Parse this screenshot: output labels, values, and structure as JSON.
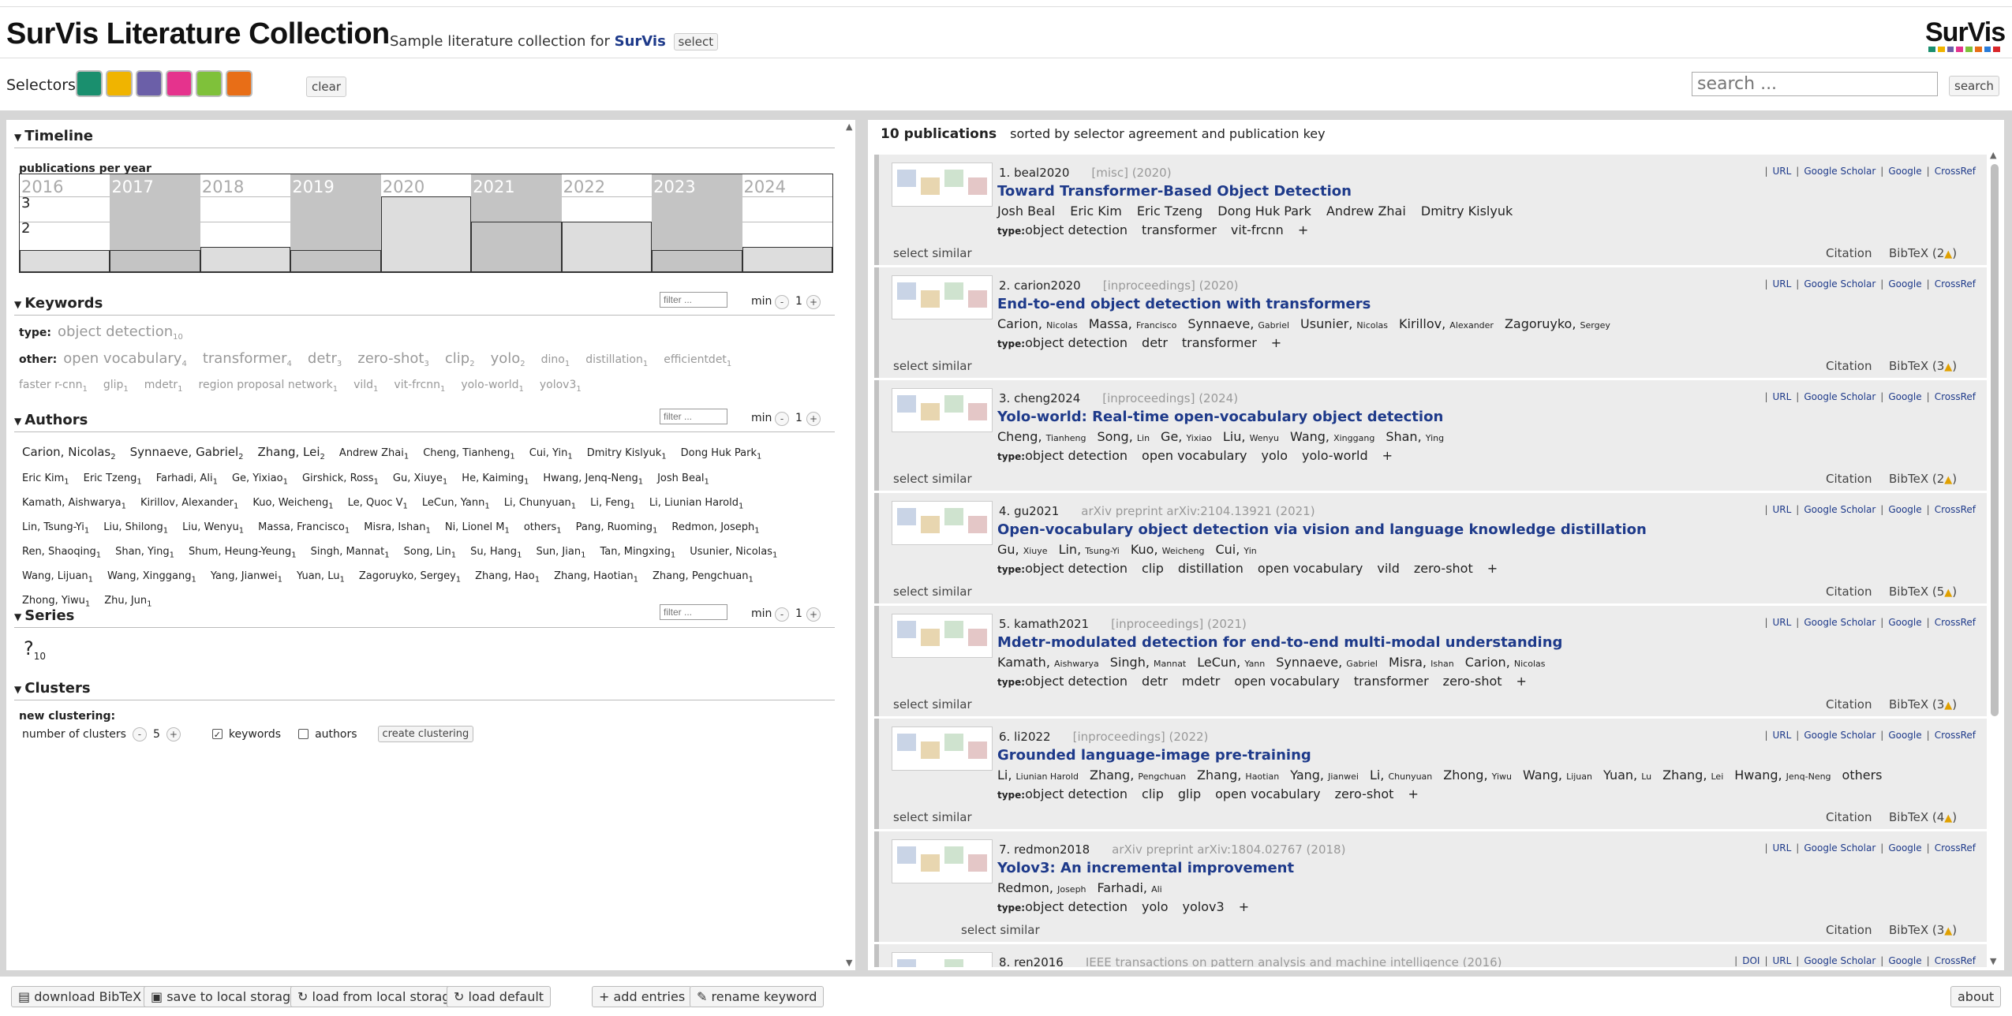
{
  "app": {
    "title": "SurVis Literature Collection",
    "subtitle_prefix": "Sample literature collection for",
    "subtitle_link": "SurVis",
    "select_label": "select",
    "logo_text": "SurVis",
    "logo_colors": [
      "#1a8f6e",
      "#f0b400",
      "#6b5fa8",
      "#e5338d",
      "#7fc13a",
      "#e86e17",
      "#2a7bd8",
      "#d9262a"
    ]
  },
  "selectors": {
    "label": "Selectors",
    "colors": [
      "#1a8f6e",
      "#f0b400",
      "#6b5fa8",
      "#e5338d",
      "#7fc13a",
      "#e86e17"
    ],
    "clear_label": "clear"
  },
  "search": {
    "placeholder": "search ...",
    "button": "search"
  },
  "timeline": {
    "section_title": "Timeline",
    "label": "publications per year",
    "ticks": [
      "3",
      "2"
    ],
    "years": [
      {
        "year": "2016",
        "count": 0
      },
      {
        "year": "2017",
        "count": 0
      },
      {
        "year": "2018",
        "count": 1
      },
      {
        "year": "2019",
        "count": 0
      },
      {
        "year": "2020",
        "count": 3
      },
      {
        "year": "2021",
        "count": 2
      },
      {
        "year": "2022",
        "count": 2
      },
      {
        "year": "2023",
        "count": 0
      },
      {
        "year": "2024",
        "count": 1
      }
    ]
  },
  "keywords": {
    "section_title": "Keywords",
    "filter_placeholder": "filter ...",
    "min_label": "min",
    "min_value": "1",
    "type_label": "type:",
    "type_tags": [
      {
        "name": "object detection",
        "count": "10"
      }
    ],
    "other_label": "other:",
    "other_tags": [
      {
        "name": "open vocabulary",
        "count": "4"
      },
      {
        "name": "transformer",
        "count": "4"
      },
      {
        "name": "detr",
        "count": "3"
      },
      {
        "name": "zero-shot",
        "count": "3"
      },
      {
        "name": "clip",
        "count": "2"
      },
      {
        "name": "yolo",
        "count": "2"
      },
      {
        "name": "dino",
        "count": "1"
      },
      {
        "name": "distillation",
        "count": "1"
      },
      {
        "name": "efficientdet",
        "count": "1"
      },
      {
        "name": "faster r-cnn",
        "count": "1"
      },
      {
        "name": "glip",
        "count": "1"
      },
      {
        "name": "mdetr",
        "count": "1"
      },
      {
        "name": "region proposal network",
        "count": "1"
      },
      {
        "name": "vild",
        "count": "1"
      },
      {
        "name": "vit-frcnn",
        "count": "1"
      },
      {
        "name": "yolo-world",
        "count": "1"
      },
      {
        "name": "yolov3",
        "count": "1"
      }
    ]
  },
  "authors": {
    "section_title": "Authors",
    "filter_placeholder": "filter ...",
    "min_label": "min",
    "min_value": "1",
    "list": [
      {
        "name": "Carion, Nicolas",
        "count": "2"
      },
      {
        "name": "Synnaeve, Gabriel",
        "count": "2"
      },
      {
        "name": "Zhang, Lei",
        "count": "2"
      },
      {
        "name": "Andrew Zhai",
        "count": "1"
      },
      {
        "name": "Cheng, Tianheng",
        "count": "1"
      },
      {
        "name": "Cui, Yin",
        "count": "1"
      },
      {
        "name": "Dmitry Kislyuk",
        "count": "1"
      },
      {
        "name": "Dong Huk Park",
        "count": "1"
      },
      {
        "name": "Eric Kim",
        "count": "1"
      },
      {
        "name": "Eric Tzeng",
        "count": "1"
      },
      {
        "name": "Farhadi, Ali",
        "count": "1"
      },
      {
        "name": "Ge, Yixiao",
        "count": "1"
      },
      {
        "name": "Girshick, Ross",
        "count": "1"
      },
      {
        "name": "Gu, Xiuye",
        "count": "1"
      },
      {
        "name": "He, Kaiming",
        "count": "1"
      },
      {
        "name": "Hwang, Jenq-Neng",
        "count": "1"
      },
      {
        "name": "Josh Beal",
        "count": "1"
      },
      {
        "name": "Kamath, Aishwarya",
        "count": "1"
      },
      {
        "name": "Kirillov, Alexander",
        "count": "1"
      },
      {
        "name": "Kuo, Weicheng",
        "count": "1"
      },
      {
        "name": "Le, Quoc V",
        "count": "1"
      },
      {
        "name": "LeCun, Yann",
        "count": "1"
      },
      {
        "name": "Li, Chunyuan",
        "count": "1"
      },
      {
        "name": "Li, Feng",
        "count": "1"
      },
      {
        "name": "Li, Liunian Harold",
        "count": "1"
      },
      {
        "name": "Lin, Tsung-Yi",
        "count": "1"
      },
      {
        "name": "Liu, Shilong",
        "count": "1"
      },
      {
        "name": "Liu, Wenyu",
        "count": "1"
      },
      {
        "name": "Massa, Francisco",
        "count": "1"
      },
      {
        "name": "Misra, Ishan",
        "count": "1"
      },
      {
        "name": "Ni, Lionel M",
        "count": "1"
      },
      {
        "name": "others",
        "count": "1"
      },
      {
        "name": "Pang, Ruoming",
        "count": "1"
      },
      {
        "name": "Redmon, Joseph",
        "count": "1"
      },
      {
        "name": "Ren, Shaoqing",
        "count": "1"
      },
      {
        "name": "Shan, Ying",
        "count": "1"
      },
      {
        "name": "Shum, Heung-Yeung",
        "count": "1"
      },
      {
        "name": "Singh, Mannat",
        "count": "1"
      },
      {
        "name": "Song, Lin",
        "count": "1"
      },
      {
        "name": "Su, Hang",
        "count": "1"
      },
      {
        "name": "Sun, Jian",
        "count": "1"
      },
      {
        "name": "Tan, Mingxing",
        "count": "1"
      },
      {
        "name": "Usunier, Nicolas",
        "count": "1"
      },
      {
        "name": "Wang, Lijuan",
        "count": "1"
      },
      {
        "name": "Wang, Xinggang",
        "count": "1"
      },
      {
        "name": "Yang, Jianwei",
        "count": "1"
      },
      {
        "name": "Yuan, Lu",
        "count": "1"
      },
      {
        "name": "Zagoruyko, Sergey",
        "count": "1"
      },
      {
        "name": "Zhang, Hao",
        "count": "1"
      },
      {
        "name": "Zhang, Haotian",
        "count": "1"
      },
      {
        "name": "Zhang, Pengchuan",
        "count": "1"
      },
      {
        "name": "Zhong, Yiwu",
        "count": "1"
      },
      {
        "name": "Zhu, Jun",
        "count": "1"
      }
    ]
  },
  "series": {
    "section_title": "Series",
    "filter_placeholder": "filter ...",
    "min_label": "min",
    "min_value": "1",
    "value": "?",
    "count": "10"
  },
  "clusters": {
    "section_title": "Clusters",
    "new_label": "new clustering:",
    "num_label": "number of clusters",
    "num_value": "5",
    "keywords_label": "keywords",
    "authors_label": "authors",
    "create_label": "create clustering"
  },
  "results": {
    "count_label": "10 publications",
    "sort_label": "sorted by selector agreement and publication key"
  },
  "common": {
    "select_similar": "select similar",
    "citation": "Citation",
    "bibtex": "BibTeX",
    "type_prefix": "type:",
    "plus": "+"
  },
  "publications": [
    {
      "num": "1.",
      "key": "beal2020",
      "kind": "[misc]",
      "year": "(2020)",
      "title": "Toward Transformer-Based Object Detection",
      "authors": [
        {
          "last": "Josh Beal",
          "first": ""
        },
        {
          "last": "Eric Kim",
          "first": ""
        },
        {
          "last": "Eric Tzeng",
          "first": ""
        },
        {
          "last": "Dong Huk Park",
          "first": ""
        },
        {
          "last": "Andrew Zhai",
          "first": ""
        },
        {
          "last": "Dmitry Kislyuk",
          "first": ""
        }
      ],
      "type": "object detection",
      "keywords": [
        "transformer",
        "vit-frcnn"
      ],
      "links": [
        "URL",
        "Google Scholar",
        "Google",
        "CrossRef"
      ],
      "bibtex_warn": "(2"
    },
    {
      "num": "2.",
      "key": "carion2020",
      "kind": "[inproceedings]",
      "year": "(2020)",
      "title": "End-to-end object detection with transformers",
      "authors": [
        {
          "last": "Carion,",
          "first": "Nicolas"
        },
        {
          "last": "Massa,",
          "first": "Francisco"
        },
        {
          "last": "Synnaeve,",
          "first": "Gabriel"
        },
        {
          "last": "Usunier,",
          "first": "Nicolas"
        },
        {
          "last": "Kirillov,",
          "first": "Alexander"
        },
        {
          "last": "Zagoruyko,",
          "first": "Sergey"
        }
      ],
      "type": "object detection",
      "keywords": [
        "detr",
        "transformer"
      ],
      "links": [
        "URL",
        "Google Scholar",
        "Google",
        "CrossRef"
      ],
      "bibtex_warn": "(3"
    },
    {
      "num": "3.",
      "key": "cheng2024",
      "kind": "[inproceedings]",
      "year": "(2024)",
      "title": "Yolo-world: Real-time open-vocabulary object detection",
      "authors": [
        {
          "last": "Cheng,",
          "first": "Tianheng"
        },
        {
          "last": "Song,",
          "first": "Lin"
        },
        {
          "last": "Ge,",
          "first": "Yixiao"
        },
        {
          "last": "Liu,",
          "first": "Wenyu"
        },
        {
          "last": "Wang,",
          "first": "Xinggang"
        },
        {
          "last": "Shan,",
          "first": "Ying"
        }
      ],
      "type": "object detection",
      "keywords": [
        "open vocabulary",
        "yolo",
        "yolo-world"
      ],
      "links": [
        "URL",
        "Google Scholar",
        "Google",
        "CrossRef"
      ],
      "bibtex_warn": "(2"
    },
    {
      "num": "4.",
      "key": "gu2021",
      "kind": "arXiv preprint arXiv:2104.13921",
      "year": "(2021)",
      "title": "Open-vocabulary object detection via vision and language knowledge distillation",
      "authors": [
        {
          "last": "Gu,",
          "first": "Xiuye"
        },
        {
          "last": "Lin,",
          "first": "Tsung-Yi"
        },
        {
          "last": "Kuo,",
          "first": "Weicheng"
        },
        {
          "last": "Cui,",
          "first": "Yin"
        }
      ],
      "type": "object detection",
      "keywords": [
        "clip",
        "distillation",
        "open vocabulary",
        "vild",
        "zero-shot"
      ],
      "links": [
        "URL",
        "Google Scholar",
        "Google",
        "CrossRef"
      ],
      "bibtex_warn": "(5"
    },
    {
      "num": "5.",
      "key": "kamath2021",
      "kind": "[inproceedings]",
      "year": "(2021)",
      "title": "Mdetr-modulated detection for end-to-end multi-modal understanding",
      "authors": [
        {
          "last": "Kamath,",
          "first": "Aishwarya"
        },
        {
          "last": "Singh,",
          "first": "Mannat"
        },
        {
          "last": "LeCun,",
          "first": "Yann"
        },
        {
          "last": "Synnaeve,",
          "first": "Gabriel"
        },
        {
          "last": "Misra,",
          "first": "Ishan"
        },
        {
          "last": "Carion,",
          "first": "Nicolas"
        }
      ],
      "type": "object detection",
      "keywords": [
        "detr",
        "mdetr",
        "open vocabulary",
        "transformer",
        "zero-shot"
      ],
      "links": [
        "URL",
        "Google Scholar",
        "Google",
        "CrossRef"
      ],
      "bibtex_warn": "(3"
    },
    {
      "num": "6.",
      "key": "li2022",
      "kind": "[inproceedings]",
      "year": "(2022)",
      "title": "Grounded language-image pre-training",
      "authors": [
        {
          "last": "Li,",
          "first": "Liunian Harold"
        },
        {
          "last": "Zhang,",
          "first": "Pengchuan"
        },
        {
          "last": "Zhang,",
          "first": "Haotian"
        },
        {
          "last": "Yang,",
          "first": "Jianwei"
        },
        {
          "last": "Li,",
          "first": "Chunyuan"
        },
        {
          "last": "Zhong,",
          "first": "Yiwu"
        },
        {
          "last": "Wang,",
          "first": "Lijuan"
        },
        {
          "last": "Yuan,",
          "first": "Lu"
        },
        {
          "last": "Zhang,",
          "first": "Lei"
        },
        {
          "last": "Hwang,",
          "first": "Jenq-Neng"
        },
        {
          "last": "others",
          "first": ""
        }
      ],
      "type": "object detection",
      "keywords": [
        "clip",
        "glip",
        "open vocabulary",
        "zero-shot"
      ],
      "links": [
        "URL",
        "Google Scholar",
        "Google",
        "CrossRef"
      ],
      "bibtex_warn": "(4"
    },
    {
      "num": "7.",
      "key": "redmon2018",
      "kind": "arXiv preprint arXiv:1804.02767",
      "year": "(2018)",
      "title": "Yolov3: An incremental improvement",
      "authors": [
        {
          "last": "Redmon,",
          "first": "Joseph"
        },
        {
          "last": "Farhadi,",
          "first": "Ali"
        }
      ],
      "type": "object detection",
      "keywords": [
        "yolo",
        "yolov3"
      ],
      "links": [
        "URL",
        "Google Scholar",
        "Google",
        "CrossRef"
      ],
      "bibtex_warn": "(3"
    },
    {
      "num": "8.",
      "key": "ren2016",
      "kind": "IEEE transactions on pattern analysis and machine intelligence",
      "year": "(2016)",
      "title": "",
      "authors": [],
      "type": "",
      "keywords": [],
      "links": [
        "DOI",
        "URL",
        "Google Scholar",
        "Google",
        "CrossRef"
      ],
      "bibtex_warn": ""
    }
  ],
  "footer": {
    "download": "download BibTeX",
    "save": "save to local storage",
    "load_local": "load from local storage",
    "load_default": "load default",
    "add": "add entries",
    "rename": "rename keyword",
    "about": "about"
  }
}
